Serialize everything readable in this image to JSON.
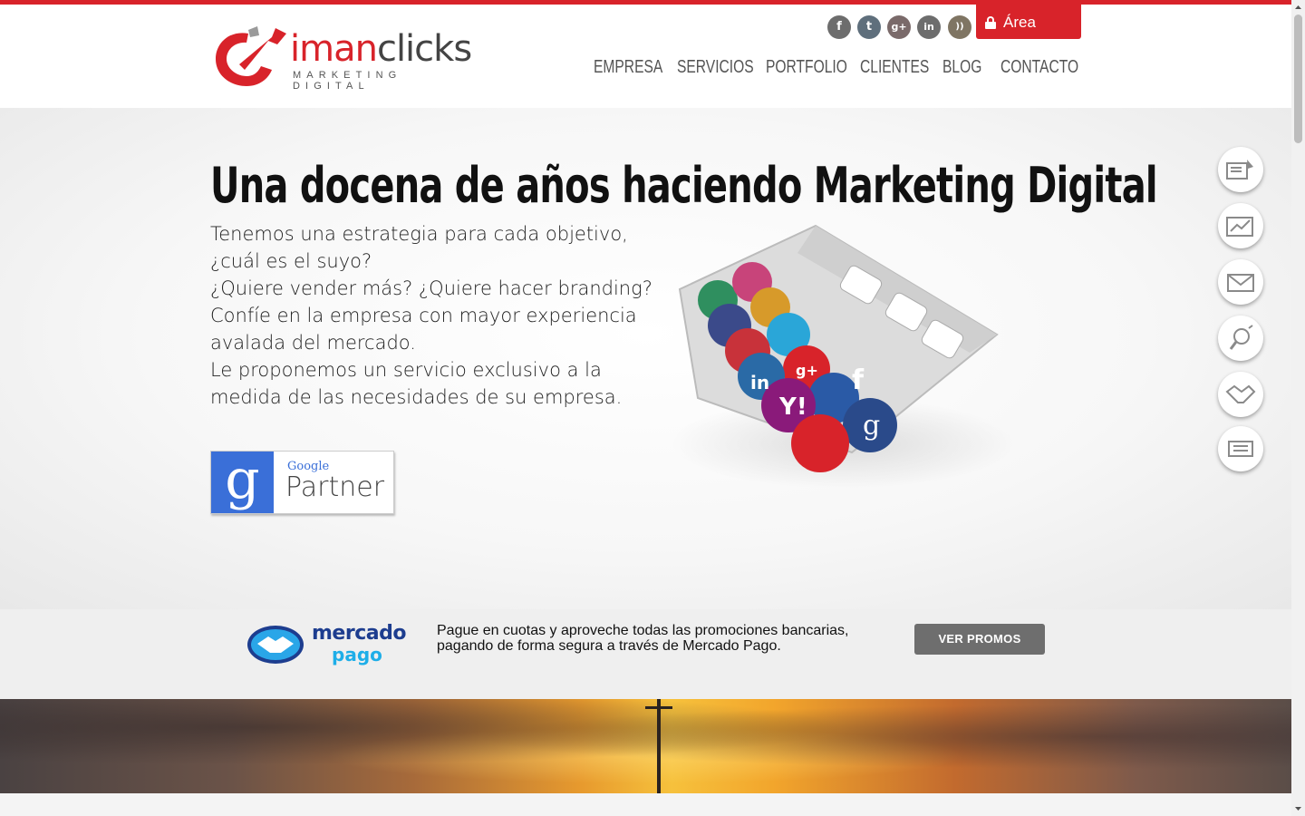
{
  "brand": {
    "name_part1": "iman",
    "name_part2": "clicks",
    "tagline": "MARKETING DIGITAL",
    "accent_color": "#d8232a"
  },
  "header": {
    "social": [
      {
        "name": "facebook-icon",
        "glyph": "f"
      },
      {
        "name": "twitter-icon",
        "glyph": "t"
      },
      {
        "name": "google-plus-icon",
        "glyph": "g+"
      },
      {
        "name": "linkedin-icon",
        "glyph": "in"
      },
      {
        "name": "rss-icon",
        "glyph": "))"
      }
    ],
    "private_area_label": "Área privada",
    "nav": [
      "EMPRESA",
      "SERVICIOS",
      "PORTFOLIO",
      "CLIENTES",
      "BLOG",
      "CONTACTO"
    ]
  },
  "hero": {
    "title": "Una docena de años haciendo Marketing Digital",
    "paragraphs": [
      "Tenemos una estrategia para cada objetivo, ¿cuál es el suyo?",
      "¿Quiere vender más? ¿Quiere hacer branding?",
      "Confíe en la empresa con mayor experiencia avalada del mercado.",
      "Le proponemos un servicio exclusivo a la medida de las necesidades de su empresa."
    ],
    "partner_badge": {
      "google": "Google",
      "partner": "Partner"
    }
  },
  "side_icons": [
    "seo-rocket-icon",
    "analytics-chart-icon",
    "email-marketing-icon",
    "social-megaphone-icon",
    "handshake-icon",
    "news-icon"
  ],
  "mercadopago": {
    "brand_line1": "mercado",
    "brand_line2": "pago",
    "text": "Pague en cuotas y aproveche todas las promociones bancarias, pagando de forma segura a través de Mercado Pago.",
    "button_label": "VER PROMOS"
  }
}
